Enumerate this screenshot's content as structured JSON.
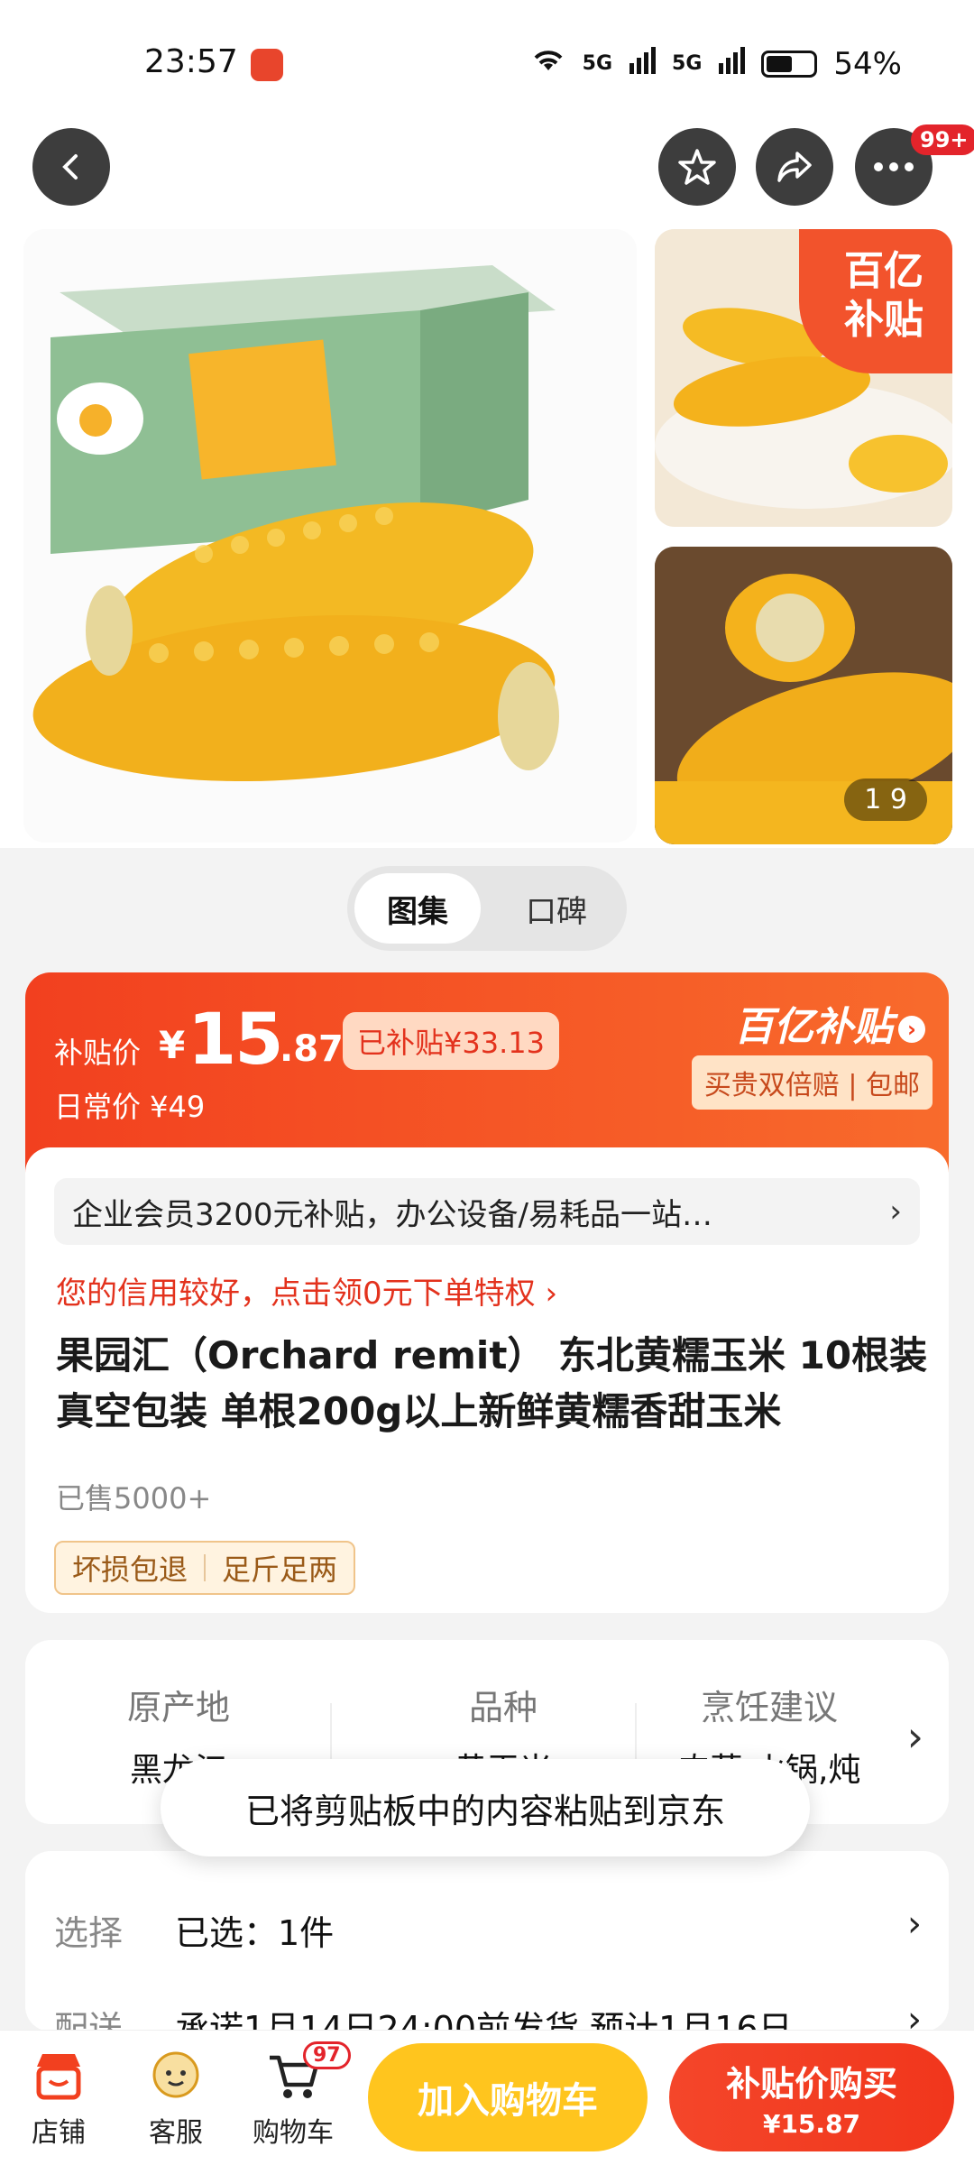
{
  "status_bar": {
    "time": "23:57",
    "network1": "5G",
    "network2": "5G",
    "battery": "54%"
  },
  "top_nav": {
    "badge": "99+"
  },
  "gallery": {
    "bybt_tag": "百亿\n补贴",
    "counter": "1 9"
  },
  "tabs": [
    {
      "label": "图集",
      "active": true
    },
    {
      "label": "口碑",
      "active": false
    }
  ],
  "price": {
    "label": "补贴价",
    "currency": "¥",
    "integer": "15",
    "decimal": ".87",
    "subsidy": "已补贴¥33.13",
    "daily": "日常价 ¥49",
    "bybt_logo": "百亿补贴",
    "guarantee": "买贵双倍赔 | 包邮"
  },
  "info": {
    "promo": "企业会员3200元补贴，办公设备/易耗品一站…",
    "credit": "您的信用较好，点击领0元下单特权 ›",
    "title": "果园汇（Orchard remit） 东北黄糯玉米 10根装 真空包装 单根200g以上新鲜黄糯香甜玉米",
    "sold": "已售5000+",
    "tags": [
      "坏损包退",
      "足斤足两"
    ]
  },
  "attributes": [
    {
      "header": "原产地",
      "value": "黑龙江"
    },
    {
      "header": "品种",
      "value": "黄玉米"
    },
    {
      "header": "烹饪建议",
      "value": "肉菜,火锅,炖"
    }
  ],
  "toast": "已将剪贴板中的内容粘贴到京东",
  "select": [
    {
      "label": "选择",
      "value": "已选：1件"
    },
    {
      "label": "配送",
      "value": "承诺1月14日24:00前发货   预计1月16日"
    }
  ],
  "bottom_bar": {
    "shop": "店铺",
    "service": "客服",
    "cart": "购物车",
    "cart_count": "97",
    "add_to_cart": "加入购物车",
    "buy_label": "补贴价购买",
    "buy_price": "¥15.87"
  },
  "colors": {
    "accent": "#f2401f",
    "cart_yellow": "#ffc51e"
  }
}
